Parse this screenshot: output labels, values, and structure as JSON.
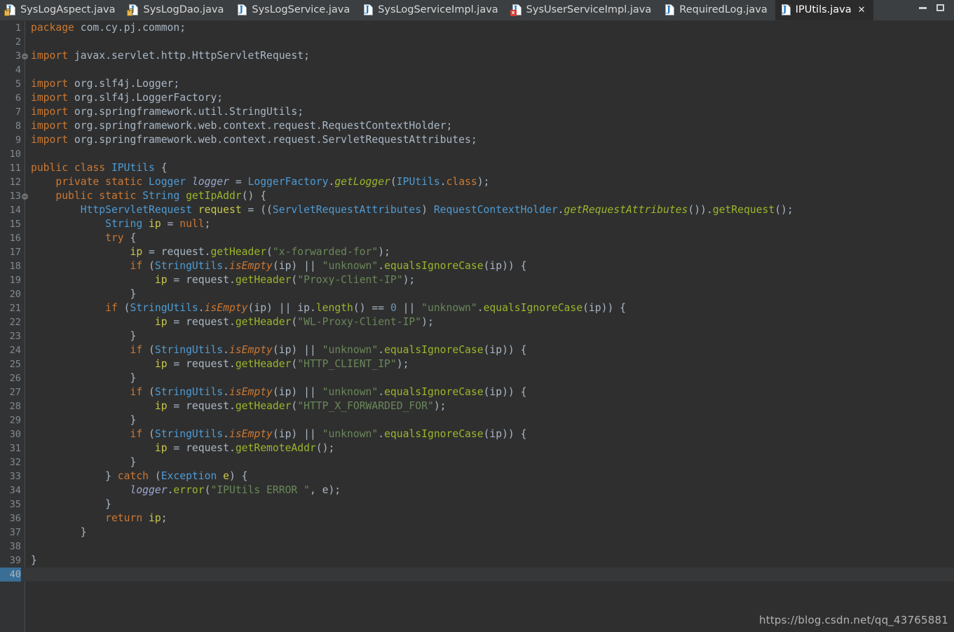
{
  "window": {
    "controls": [
      {
        "name": "minimize",
        "glyph": "minimize-icon"
      },
      {
        "name": "maximize",
        "glyph": "maximize-icon"
      }
    ]
  },
  "tabs": [
    {
      "label": "SysLogAspect.java",
      "icon": "java-file-locked-icon",
      "badge": "lock",
      "active": false,
      "closable": false
    },
    {
      "label": "SysLogDao.java",
      "icon": "java-file-locked-icon",
      "badge": "lock",
      "active": false,
      "closable": false
    },
    {
      "label": "SysLogService.java",
      "icon": "java-file-icon",
      "badge": "none",
      "active": false,
      "closable": false
    },
    {
      "label": "SysLogServiceImpl.java",
      "icon": "java-file-icon",
      "badge": "none",
      "active": false,
      "closable": false
    },
    {
      "label": "SysUserServiceImpl.java",
      "icon": "java-file-error-icon",
      "badge": "error",
      "active": false,
      "closable": false
    },
    {
      "label": "RequiredLog.java",
      "icon": "java-file-icon",
      "badge": "none",
      "active": false,
      "closable": false
    },
    {
      "label": "IPUtils.java",
      "icon": "java-file-icon",
      "badge": "none",
      "active": true,
      "closable": true
    }
  ],
  "tab_close_glyph": "✕",
  "editor": {
    "current_line": 40,
    "total_lines": 40,
    "fold_markers": [
      3,
      13
    ],
    "lines": [
      {
        "n": 1,
        "html": "<span class=\"kw\">package</span> com.cy.pj.common;"
      },
      {
        "n": 2,
        "html": ""
      },
      {
        "n": 3,
        "html": "<span class=\"kw\">import</span> javax.servlet.http.HttpServletRequest;"
      },
      {
        "n": 4,
        "html": ""
      },
      {
        "n": 5,
        "html": "<span class=\"kw\">import</span> org.slf4j.Logger;"
      },
      {
        "n": 6,
        "html": "<span class=\"kw\">import</span> org.slf4j.LoggerFactory;"
      },
      {
        "n": 7,
        "html": "<span class=\"kw\">import</span> org.springframework.util.StringUtils;"
      },
      {
        "n": 8,
        "html": "<span class=\"kw\">import</span> org.springframework.web.context.request.RequestContextHolder;"
      },
      {
        "n": 9,
        "html": "<span class=\"kw\">import</span> org.springframework.web.context.request.ServletRequestAttributes;"
      },
      {
        "n": 10,
        "html": ""
      },
      {
        "n": 11,
        "html": "<span class=\"kw\">public class</span> <span class=\"typ\">IPUtils</span> {"
      },
      {
        "n": 12,
        "html": "    <span class=\"kw\">private static</span> <span class=\"typ\">Logger</span> <span class=\"fldi\">logger</span> = <span class=\"typ\">LoggerFactory</span>.<span class=\"fni\">getLogger</span>(<span class=\"typ\">IPUtils</span>.<span class=\"kw\">class</span>);"
      },
      {
        "n": 13,
        "html": "    <span class=\"kw\">public static</span> <span class=\"typ\">String</span> <span class=\"fn\">getIpAddr</span>() {"
      },
      {
        "n": 14,
        "html": "        <span class=\"typ\">HttpServletRequest</span> <span class=\"fld\">request</span> = ((<span class=\"typ\">ServletRequestAttributes</span>) <span class=\"typ\">RequestContextHolder</span>.<span class=\"fni\">getRequestAttributes</span>()).<span class=\"fn\">getRequest</span>();"
      },
      {
        "n": 15,
        "html": "            <span class=\"typ\">String</span> <span class=\"fld\">ip</span> = <span class=\"kw\">null</span>;"
      },
      {
        "n": 16,
        "html": "            <span class=\"kw\">try</span> {"
      },
      {
        "n": 17,
        "html": "                <span class=\"fld\">ip</span> = request.<span class=\"fn\">getHeader</span>(<span class=\"str\">\"x-forwarded-for\"</span>);"
      },
      {
        "n": 18,
        "html": "                <span class=\"kw\">if</span> (<span class=\"typ\">StringUtils</span>.<span class=\"kw-i\">isEmpty</span>(ip) <span class=\"pl\">||</span> <span class=\"str\">\"unknown\"</span>.<span class=\"fn\">equalsIgnoreCase</span>(ip)) {"
      },
      {
        "n": 19,
        "html": "                    <span class=\"fld\">ip</span> = request.<span class=\"fn\">getHeader</span>(<span class=\"str\">\"Proxy-Client-IP\"</span>);"
      },
      {
        "n": 20,
        "html": "                }"
      },
      {
        "n": 21,
        "html": "            <span class=\"kw\">if</span> (<span class=\"typ\">StringUtils</span>.<span class=\"kw-i\">isEmpty</span>(ip) <span class=\"pl\">||</span> ip.<span class=\"fn\">length</span>() == <span class=\"num\">0</span> <span class=\"pl\">||</span> <span class=\"str\">\"unknown\"</span>.<span class=\"fn\">equalsIgnoreCase</span>(ip)) {"
      },
      {
        "n": 22,
        "html": "                    <span class=\"fld\">ip</span> = request.<span class=\"fn\">getHeader</span>(<span class=\"str\">\"WL-Proxy-Client-IP\"</span>);"
      },
      {
        "n": 23,
        "html": "                }"
      },
      {
        "n": 24,
        "html": "                <span class=\"kw\">if</span> (<span class=\"typ\">StringUtils</span>.<span class=\"kw-i\">isEmpty</span>(ip) <span class=\"pl\">||</span> <span class=\"str\">\"unknown\"</span>.<span class=\"fn\">equalsIgnoreCase</span>(ip)) {"
      },
      {
        "n": 25,
        "html": "                    <span class=\"fld\">ip</span> = request.<span class=\"fn\">getHeader</span>(<span class=\"str\">\"HTTP_CLIENT_IP\"</span>);"
      },
      {
        "n": 26,
        "html": "                }"
      },
      {
        "n": 27,
        "html": "                <span class=\"kw\">if</span> (<span class=\"typ\">StringUtils</span>.<span class=\"kw-i\">isEmpty</span>(ip) <span class=\"pl\">||</span> <span class=\"str\">\"unknown\"</span>.<span class=\"fn\">equalsIgnoreCase</span>(ip)) {"
      },
      {
        "n": 28,
        "html": "                    <span class=\"fld\">ip</span> = request.<span class=\"fn\">getHeader</span>(<span class=\"str\">\"HTTP_X_FORWARDED_FOR\"</span>);"
      },
      {
        "n": 29,
        "html": "                }"
      },
      {
        "n": 30,
        "html": "                <span class=\"kw\">if</span> (<span class=\"typ\">StringUtils</span>.<span class=\"kw-i\">isEmpty</span>(ip) <span class=\"pl\">||</span> <span class=\"str\">\"unknown\"</span>.<span class=\"fn\">equalsIgnoreCase</span>(ip)) {"
      },
      {
        "n": 31,
        "html": "                    <span class=\"fld\">ip</span> = request.<span class=\"fn\">getRemoteAddr</span>();"
      },
      {
        "n": 32,
        "html": "                }"
      },
      {
        "n": 33,
        "html": "            } <span class=\"kw\">catch</span> (<span class=\"typ\">Exception</span> <span class=\"fld\">e</span>) {"
      },
      {
        "n": 34,
        "html": "                <span class=\"fldi\">logger</span>.<span class=\"fn\">error</span>(<span class=\"str\">\"IPUtils ERROR \"</span>, e);"
      },
      {
        "n": 35,
        "html": "            }"
      },
      {
        "n": 36,
        "html": "            <span class=\"kw\">return</span> <span class=\"fld\">ip</span>;"
      },
      {
        "n": 37,
        "html": "        }"
      },
      {
        "n": 38,
        "html": ""
      },
      {
        "n": 39,
        "html": "}"
      },
      {
        "n": 40,
        "html": ""
      }
    ]
  },
  "watermark": "https://blog.csdn.net/qq_43765881",
  "colors": {
    "editor_background": "#2f2f2f",
    "gutter_background": "#313335",
    "tabbar_background": "#3c3f41",
    "active_tab_background": "#2b2b2b",
    "current_line_background": "#353739",
    "current_line_number_background": "#3a6e96",
    "default_text": "#a9b7c6",
    "keyword": "#cc7832",
    "string": "#6a8759",
    "type": "#4e9bd4",
    "method": "#9ab62a",
    "field": "#c9c94b",
    "number": "#6897bb"
  }
}
